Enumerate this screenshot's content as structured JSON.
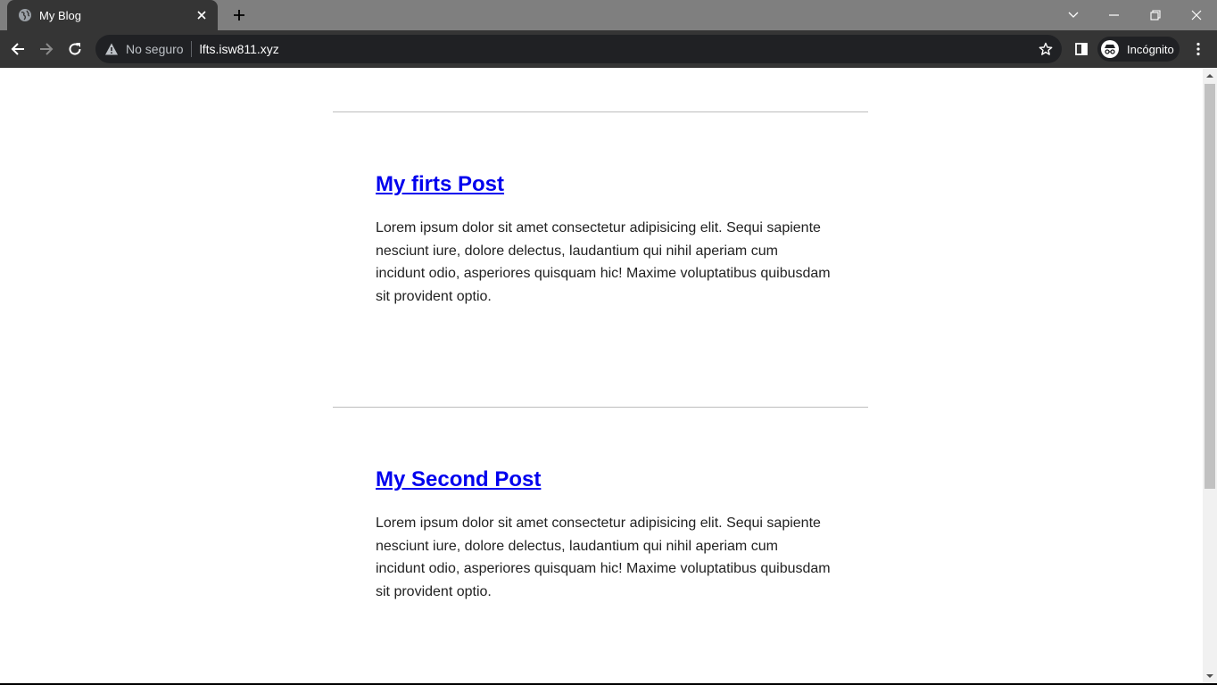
{
  "browser": {
    "tab": {
      "title": "My Blog",
      "favicon": "globe-icon",
      "close_icon": "close-icon"
    },
    "new_tab_icon": "plus-icon",
    "window_controls": [
      "chevron-down-icon",
      "minimize-icon",
      "restore-icon",
      "close-icon"
    ],
    "toolbar": {
      "back_icon": "arrow-left-icon",
      "forward_icon": "arrow-right-icon",
      "reload_icon": "reload-icon",
      "security_label": "No seguro",
      "url": "lfts.isw811.xyz",
      "bookmark_icon": "star-icon",
      "side_panel_icon": "side-panel-icon",
      "profile_label": "Incógnito",
      "menu_icon": "kebab-menu-icon"
    }
  },
  "posts": [
    {
      "title": "My firts Post",
      "excerpt": "Lorem ipsum dolor sit amet consectetur adipisicing elit. Sequi sapiente nesciunt iure, dolore delectus, laudantium qui nihil aperiam cum incidunt odio, asperiores quisquam hic! Maxime voluptatibus quibusdam sit provident optio."
    },
    {
      "title": "My Second Post",
      "excerpt": "Lorem ipsum dolor sit amet consectetur adipisicing elit. Sequi sapiente nesciunt iure, dolore delectus, laudantium qui nihil aperiam cum incidunt odio, asperiores quisquam hic! Maxime voluptatibus quibusdam sit provident optio."
    }
  ],
  "colors": {
    "link": "#0000ee",
    "tab_bg": "#353535",
    "tabstrip_bg": "#7f7f7f",
    "omnibox_bg": "#202124"
  }
}
